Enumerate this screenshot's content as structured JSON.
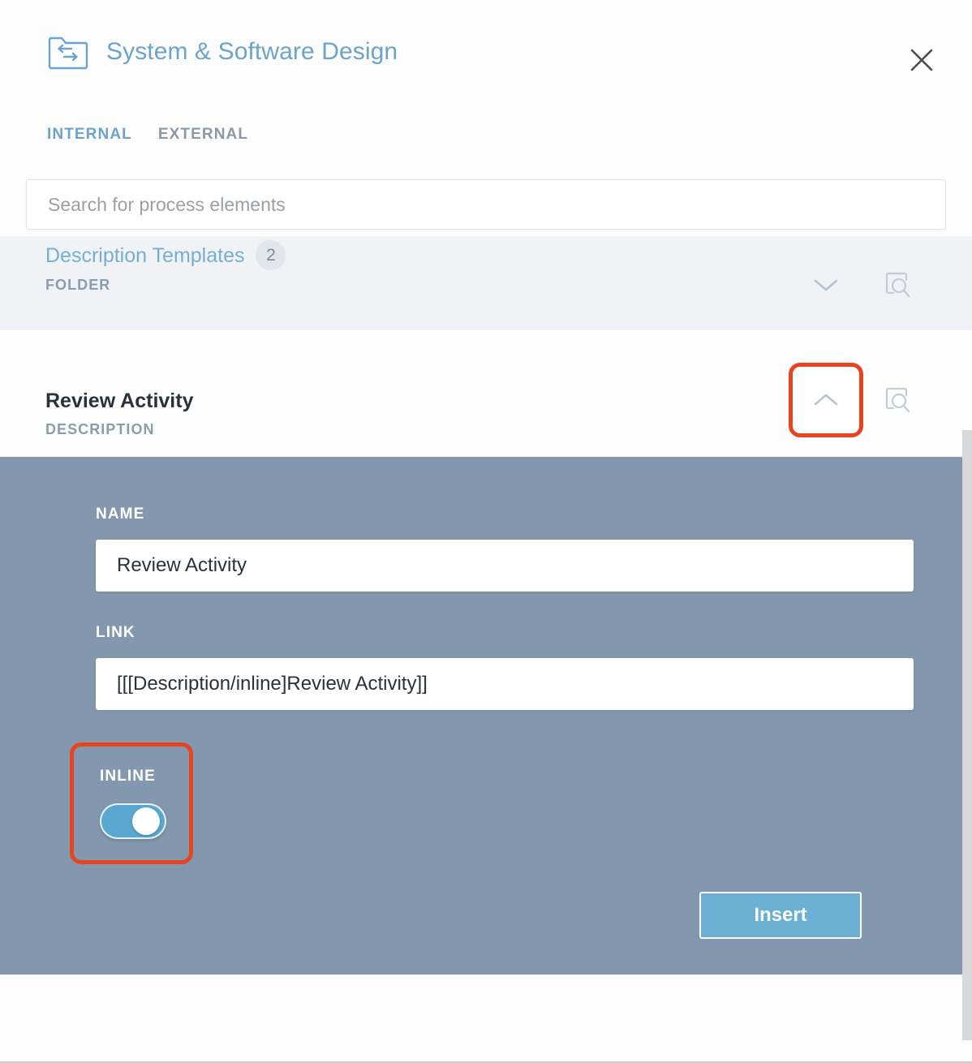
{
  "dialog": {
    "title": "System & Software Design",
    "folder_icon": "folder-exchange-icon",
    "close_icon": "close-icon",
    "accent_blue": "#6aa4cc",
    "panel_bg": "#8398ae",
    "highlight_red": "#e8441f"
  },
  "tabs": [
    {
      "label": "INTERNAL",
      "active": true
    },
    {
      "label": "EXTERNAL",
      "active": false
    }
  ],
  "search": {
    "placeholder": "Search for process elements",
    "value": ""
  },
  "results": [
    {
      "title": "Description Templates",
      "badge": "2",
      "type": "FOLDER",
      "expanded": false,
      "chevron_icon": "chevron-down-icon",
      "preview_icon": "preview-search-icon",
      "highlighted": false
    },
    {
      "title": "Review Activity",
      "badge": "",
      "type": "DESCRIPTION",
      "expanded": true,
      "chevron_icon": "chevron-up-icon",
      "preview_icon": "preview-search-icon",
      "highlighted": true
    }
  ],
  "panel": {
    "name_label": "NAME",
    "name_value": "Review Activity",
    "name_placeholder": "Name",
    "link_label": "LINK",
    "link_value": "[[[Description/inline]Review Activity]]",
    "link_placeholder": "Link",
    "inline_label": "INLINE",
    "inline_enabled": true,
    "insert_label": "Insert"
  }
}
